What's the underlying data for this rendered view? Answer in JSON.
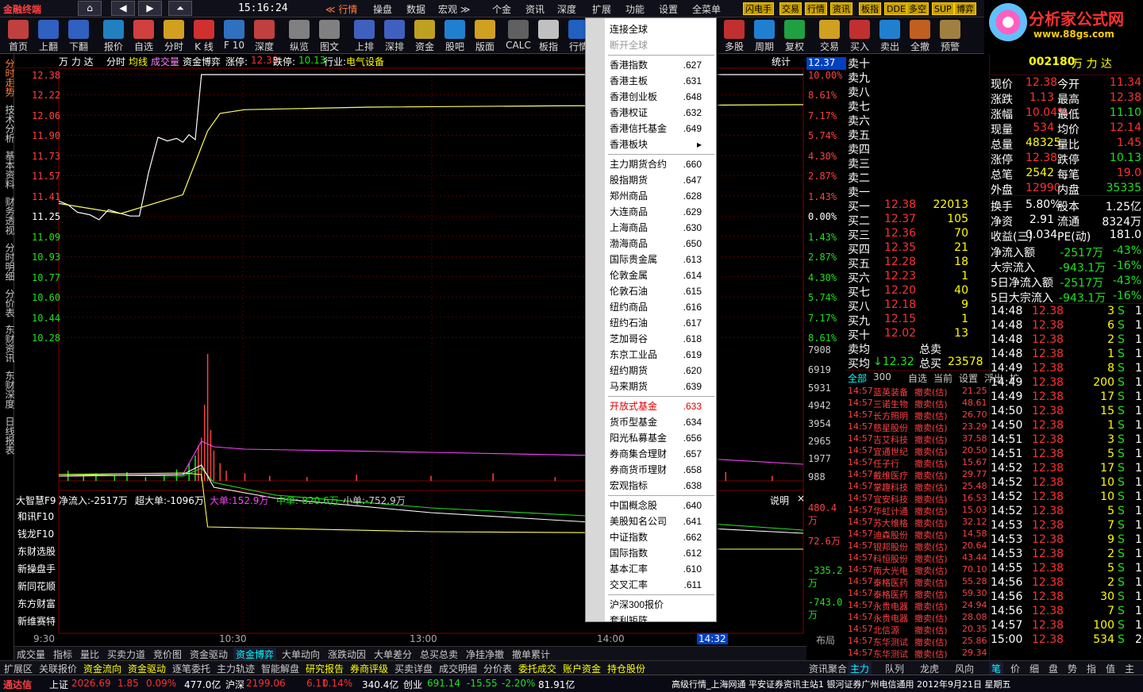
{
  "app": {
    "name": "金融终端",
    "clock": "15:16:24"
  },
  "nav": {
    "home": "⌂",
    "back": "◀",
    "fwd": "▶",
    "up": "⏶"
  },
  "topmenu": [
    {
      "label": "≪ 行情",
      "active": true
    },
    {
      "label": "操盘"
    },
    {
      "label": "数据"
    },
    {
      "label": "宏观 ≫"
    },
    {
      "label": "个金"
    },
    {
      "label": "资讯"
    },
    {
      "label": "深度"
    },
    {
      "label": "扩展",
      "active": false
    },
    {
      "label": "功能"
    },
    {
      "label": "设置"
    },
    {
      "label": "全菜单"
    }
  ],
  "quickbtns": [
    "闪电手",
    "交易",
    "行情",
    "资讯",
    "板指",
    "DDE",
    "多空",
    "SUP",
    "博弈"
  ],
  "logo": {
    "title": "分析家公式网",
    "url": "www.88gs.com"
  },
  "toolbar": [
    "首页",
    "上翻",
    "下翻",
    "报价",
    "自选",
    "分时",
    "K 线",
    "F 10",
    "深度",
    "纵览",
    "图文",
    "上排",
    "深排",
    "资金",
    "股吧",
    "版面",
    "CALC",
    "板指",
    "行情",
    "多股",
    "周期",
    "复权",
    "交易",
    "买入",
    "卖出",
    "全撤",
    "预警"
  ],
  "sidetabs": [
    "分时走势",
    "技术分析",
    "基本资料",
    "财务透视",
    "分时明细",
    "分价表",
    "东财资讯",
    "东财深度",
    "日线报表"
  ],
  "header": {
    "name": "万 力 达",
    "mode": "分时",
    "avg": "均线",
    "vol": "成交量",
    "tab": "资金博弈",
    "zt_label": "涨停:",
    "zt": "12.38",
    "dt_label": "跌停:",
    "dt": "10.13",
    "ind_label": "行业:",
    "ind": "电气设备",
    "stat": "统计",
    "cur": "12.37"
  },
  "yaxis": {
    "left": [
      "12.38",
      "12.22",
      "12.06",
      "11.90",
      "11.73",
      "11.57",
      "11.41",
      "11.25",
      "11.09",
      "10.93",
      "10.77",
      "10.60",
      "10.44",
      "10.28"
    ],
    "right": [
      "10.00%",
      "8.61%",
      "7.17%",
      "5.74%",
      "4.30%",
      "2.87%",
      "1.43%",
      "0.00%",
      "1.43%",
      "2.87%",
      "4.30%",
      "5.74%",
      "7.17%",
      "8.61%"
    ],
    "vol": [
      "7908",
      "6919",
      "5931",
      "4942",
      "3954",
      "2965",
      "1977",
      "988"
    ]
  },
  "dde": {
    "title": "大智慧F9",
    "net": "净流入:-2517万",
    "super": "超大单:-1096万",
    "big": "大单:152.9万",
    "mid": "中单:-820.6万",
    "small": "小单:-752.9万",
    "help": "说明",
    "right": [
      "480.4万",
      "72.6万",
      "-335.2万",
      "-743.0万"
    ]
  },
  "leftlinks": [
    "和讯F10",
    "钱龙F10",
    "东财选股",
    "新操盘手",
    "新同花顺",
    "东方财富",
    "新维赛特"
  ],
  "xaxis": [
    "9:30",
    "10:30",
    "13:00",
    "14:00",
    "14:32",
    "布局"
  ],
  "sell": [
    {
      "l": "卖十"
    },
    {
      "l": "卖九"
    },
    {
      "l": "卖八"
    },
    {
      "l": "卖七"
    },
    {
      "l": "卖六"
    },
    {
      "l": "卖五"
    },
    {
      "l": "卖四"
    },
    {
      "l": "卖三"
    },
    {
      "l": "卖二"
    },
    {
      "l": "卖一"
    }
  ],
  "buy": [
    {
      "l": "买一",
      "p": "12.38",
      "v": "22013"
    },
    {
      "l": "买二",
      "p": "12.37",
      "v": "105"
    },
    {
      "l": "买三",
      "p": "12.36",
      "v": "70"
    },
    {
      "l": "买四",
      "p": "12.35",
      "v": "21"
    },
    {
      "l": "买五",
      "p": "12.28",
      "v": "18"
    },
    {
      "l": "买六",
      "p": "12.23",
      "v": "1"
    },
    {
      "l": "买七",
      "p": "12.20",
      "v": "40"
    },
    {
      "l": "买八",
      "p": "12.18",
      "v": "9"
    },
    {
      "l": "买九",
      "p": "12.15",
      "v": "1"
    },
    {
      "l": "买十",
      "p": "12.02",
      "v": "13"
    }
  ],
  "avgrow": {
    "sell_l": "卖均",
    "sell_t": "总卖",
    "buy_l": "买均",
    "buy_p": "↓12.32",
    "buy_t": "总买",
    "buy_v": "23578"
  },
  "stock": {
    "code": "002180",
    "name": "万 力 达"
  },
  "quote": [
    {
      "a": "现价",
      "b": "12.38",
      "c": "今开",
      "d": "11.34"
    },
    {
      "a": "涨跌",
      "b": "1.13",
      "c": "最高",
      "d": "12.38"
    },
    {
      "a": "涨幅",
      "b": "10.04%",
      "c": "最低",
      "d": "11.10"
    },
    {
      "a": "现量",
      "b": "534",
      "c": "均价",
      "d": "12.14"
    },
    {
      "a": "总量",
      "b": "48325",
      "c": "量比",
      "d": "1.45"
    },
    {
      "a": "涨停",
      "b": "12.38",
      "c": "跌停",
      "d": "10.13"
    },
    {
      "a": "总笔",
      "b": "2542",
      "c": "每笔",
      "d": "19.0"
    },
    {
      "a": "外盘",
      "b": "12990",
      "c": "内盘",
      "d": "35335"
    }
  ],
  "fin": [
    {
      "a": "换手",
      "b": "5.80%",
      "c": "股本",
      "d": "1.25亿"
    },
    {
      "a": "净资",
      "b": "2.91",
      "c": "流通",
      "d": "8324万"
    },
    {
      "a": "收益(三)",
      "b": "0.034",
      "c": "PE(动)",
      "d": "181.0"
    }
  ],
  "flow": [
    {
      "a": "净流入额",
      "b": "-2517万",
      "c": "-43%"
    },
    {
      "a": "大宗流入",
      "b": "-943.1万",
      "c": "-16%"
    },
    {
      "a": "5日净流入额",
      "b": "-2517万",
      "c": "-43%"
    },
    {
      "a": "5日大宗流入",
      "b": "-943.1万",
      "c": "-16%"
    }
  ],
  "ticks": [
    {
      "t": "14:48",
      "p": "12.38",
      "v": "3",
      "s": "S",
      "n": "1"
    },
    {
      "t": "14:48",
      "p": "12.38",
      "v": "6",
      "s": "S",
      "n": "1"
    },
    {
      "t": "14:48",
      "p": "12.38",
      "v": "2",
      "s": "S",
      "n": "1"
    },
    {
      "t": "14:48",
      "p": "12.38",
      "v": "1",
      "s": "S",
      "n": "1"
    },
    {
      "t": "14:49",
      "p": "12.38",
      "v": "8",
      "s": "S",
      "n": "1"
    },
    {
      "t": "14:49",
      "p": "12.38",
      "v": "200",
      "s": "S",
      "n": "1"
    },
    {
      "t": "14:49",
      "p": "12.38",
      "v": "17",
      "s": "S",
      "n": "1"
    },
    {
      "t": "14:50",
      "p": "12.38",
      "v": "15",
      "s": "S",
      "n": "1"
    },
    {
      "t": "14:50",
      "p": "12.38",
      "v": "1",
      "s": "S",
      "n": "1"
    },
    {
      "t": "14:51",
      "p": "12.38",
      "v": "3",
      "s": "S",
      "n": "1"
    },
    {
      "t": "14:51",
      "p": "12.38",
      "v": "5",
      "s": "S",
      "n": "1"
    },
    {
      "t": "14:52",
      "p": "12.38",
      "v": "17",
      "s": "S",
      "n": "1"
    },
    {
      "t": "14:52",
      "p": "12.38",
      "v": "10",
      "s": "S",
      "n": "1"
    },
    {
      "t": "14:52",
      "p": "12.38",
      "v": "10",
      "s": "S",
      "n": "1"
    },
    {
      "t": "14:52",
      "p": "12.38",
      "v": "5",
      "s": "S",
      "n": "1"
    },
    {
      "t": "14:53",
      "p": "12.38",
      "v": "7",
      "s": "S",
      "n": "1"
    },
    {
      "t": "14:53",
      "p": "12.38",
      "v": "9",
      "s": "S",
      "n": "1"
    },
    {
      "t": "14:53",
      "p": "12.38",
      "v": "2",
      "s": "S",
      "n": "1"
    },
    {
      "t": "14:55",
      "p": "12.38",
      "v": "5",
      "s": "S",
      "n": "1"
    },
    {
      "t": "14:56",
      "p": "12.38",
      "v": "2",
      "s": "S",
      "n": "1"
    },
    {
      "t": "14:56",
      "p": "12.38",
      "v": "30",
      "s": "S",
      "n": "1"
    },
    {
      "t": "14:56",
      "p": "12.38",
      "v": "7",
      "s": "S",
      "n": "1"
    },
    {
      "t": "14:57",
      "p": "12.38",
      "v": "100",
      "s": "S",
      "n": "1"
    },
    {
      "t": "15:00",
      "p": "12.38",
      "v": "534",
      "s": "S",
      "n": "20"
    }
  ],
  "newsTabs": [
    "全部",
    "300",
    "自选",
    "当前",
    "设置",
    "浮出",
    "扩"
  ],
  "news": [
    {
      "t": "14:57",
      "n": "蓝英装备",
      "a": "撤卖(估)",
      "v": "21.25"
    },
    {
      "t": "14:57",
      "n": "三诺生物",
      "a": "撤卖(估)",
      "v": "48.61"
    },
    {
      "t": "14:57",
      "n": "长方照明",
      "a": "撤卖(估)",
      "v": "26.70"
    },
    {
      "t": "14:57",
      "n": "慈星股份",
      "a": "撤卖(估)",
      "v": "23.29"
    },
    {
      "t": "14:57",
      "n": "吉艾科技",
      "a": "撤卖(估)",
      "v": "37.58"
    },
    {
      "t": "14:57",
      "n": "宜通世纪",
      "a": "撤卖(估)",
      "v": "20.50"
    },
    {
      "t": "14:57",
      "n": "任子行",
      "a": "撤卖(估)",
      "v": "15.67"
    },
    {
      "t": "14:57",
      "n": "戴维医疗",
      "a": "撤卖(估)",
      "v": "29.77"
    },
    {
      "t": "14:57",
      "n": "掌趣科技",
      "a": "撤卖(估)",
      "v": "25.48"
    },
    {
      "t": "14:57",
      "n": "宜安科技",
      "a": "撤卖(估)",
      "v": "16.53"
    },
    {
      "t": "14:57",
      "n": "华虹计通",
      "a": "撤卖(估)",
      "v": "15.03"
    },
    {
      "t": "14:57",
      "n": "苏大维格",
      "a": "撤卖(估)",
      "v": "32.12"
    },
    {
      "t": "14:57",
      "n": "迪森股份",
      "a": "撤卖(估)",
      "v": "14.58"
    },
    {
      "t": "14:57",
      "n": "银邦股份",
      "a": "撤卖(估)",
      "v": "20.64"
    },
    {
      "t": "14:57",
      "n": "科恒股份",
      "a": "撤卖(估)",
      "v": "43.44"
    },
    {
      "t": "14:57",
      "n": "南大光电",
      "a": "撤卖(估)",
      "v": "70.10"
    },
    {
      "t": "14:57",
      "n": "泰格医药",
      "a": "撤卖(估)",
      "v": "55.28"
    },
    {
      "t": "14:57",
      "n": "泰格医药",
      "a": "撤卖(估)",
      "v": "59.30"
    },
    {
      "t": "14:57",
      "n": "永贵电器",
      "a": "撤卖(估)",
      "v": "24.94"
    },
    {
      "t": "14:57",
      "n": "永贵电器",
      "a": "撤卖(估)",
      "v": "28.08"
    },
    {
      "t": "14:57",
      "n": "北信源",
      "a": "撤卖(估)",
      "v": "20.35"
    },
    {
      "t": "14:57",
      "n": "东华测试",
      "a": "撤卖(估)",
      "v": "25.86"
    },
    {
      "t": "14:57",
      "n": "东华测试",
      "a": "撤卖(估)",
      "v": "29.34"
    }
  ],
  "dropdown": [
    {
      "label": "连接全球",
      "code": ""
    },
    {
      "label": "断开全球",
      "code": "",
      "disabled": true
    },
    {
      "sep": true
    },
    {
      "label": "香港指数",
      "code": ".627"
    },
    {
      "label": "香港主板",
      "code": ".631"
    },
    {
      "label": "香港创业板",
      "code": ".648"
    },
    {
      "label": "香港权证",
      "code": ".632"
    },
    {
      "label": "香港信托基金",
      "code": ".649"
    },
    {
      "label": "香港板块",
      "code": "▸"
    },
    {
      "sep": true
    },
    {
      "label": "主力期货合约",
      "code": ".660"
    },
    {
      "label": "股指期货",
      "code": ".647"
    },
    {
      "label": "郑州商品",
      "code": ".628"
    },
    {
      "label": "大连商品",
      "code": ".629"
    },
    {
      "label": "上海商品",
      "code": ".630"
    },
    {
      "label": "渤海商品",
      "code": ".650"
    },
    {
      "label": "国际贵金属",
      "code": ".613"
    },
    {
      "label": "伦敦金属",
      "code": ".614"
    },
    {
      "label": "伦敦石油",
      "code": ".615"
    },
    {
      "label": "纽约商品",
      "code": ".616"
    },
    {
      "label": "纽约石油",
      "code": ".617"
    },
    {
      "label": "芝加哥谷",
      "code": ".618"
    },
    {
      "label": "东京工业品",
      "code": ".619"
    },
    {
      "label": "纽约期货",
      "code": ".620"
    },
    {
      "label": "马来期货",
      "code": ".639"
    },
    {
      "sep": true
    },
    {
      "label": "开放式基金",
      "code": ".633",
      "hl": true
    },
    {
      "label": "货币型基金",
      "code": ".634"
    },
    {
      "label": "阳光私募基金",
      "code": ".656"
    },
    {
      "label": "券商集合理财",
      "code": ".657"
    },
    {
      "label": "券商货币理财",
      "code": ".658"
    },
    {
      "label": "宏观指标",
      "code": ".638"
    },
    {
      "sep": true
    },
    {
      "label": "中国概念股",
      "code": ".640"
    },
    {
      "label": "美股知名公司",
      "code": ".641"
    },
    {
      "label": "中证指数",
      "code": ".662"
    },
    {
      "label": "国际指数",
      "code": ".612"
    },
    {
      "label": "基本汇率",
      "code": ".610"
    },
    {
      "label": "交叉汇率",
      "code": ".611"
    },
    {
      "sep": true
    },
    {
      "label": "沪深300报价",
      "code": ""
    },
    {
      "label": "套利矩阵",
      "code": ""
    }
  ],
  "bottomtabs": [
    "成交量",
    "指标",
    "量比",
    "买卖力道",
    "竞价图",
    "资金驱动",
    "资金博弈",
    "大单动向",
    "涨跌动因",
    "大单差分",
    "总买总卖",
    "净挂净撤",
    "撤单累计"
  ],
  "bottomtabs2": [
    "扩展区",
    "关联报价",
    "资金流向",
    "资金驱动",
    "逐笔委托",
    "主力轨迹",
    "智能解盘",
    "研究报告",
    "券商评级",
    "买卖详盘",
    "成交明细",
    "分价表",
    "委托成交",
    "账户资金",
    "持仓股份"
  ],
  "rightbottom": [
    "资讯聚合"
  ],
  "rtabs": [
    "主力",
    "队列",
    "龙虎",
    "风向"
  ],
  "rtabs2": [
    "笔",
    "价",
    "细",
    "盘",
    "势",
    "指",
    "值",
    "主"
  ],
  "status": {
    "brand": "通达信",
    "sh_l": "上证",
    "sh": "2026.69",
    "sh_c": "1.85",
    "sh_p": "0.09%",
    "sh_v": "477.0亿",
    "hs_l": "沪深",
    "hs": "2199.06",
    "hs_c": "6.11",
    "hs_p": "0.14%",
    "hs_v": "340.4亿",
    "cy_l": "创业",
    "cy": "691.14",
    "cy_c": "-15.55",
    "cy_p": "-2.20%",
    "cy_v": "81.91亿",
    "info": "高级行情_上海网通  平安证券资讯主站1  银河证券广州电信通用  2012年9月21日 星期五"
  },
  "chart_data": {
    "type": "line",
    "price_x": [
      0,
      3,
      6,
      10,
      13,
      16,
      20,
      23,
      26,
      29,
      32,
      35,
      38,
      40,
      42,
      44,
      46,
      48,
      50,
      54,
      60,
      70,
      100,
      150,
      200,
      240
    ],
    "price": [
      11.37,
      11.34,
      11.28,
      11.26,
      11.22,
      11.3,
      11.27,
      11.25,
      11.25,
      11.6,
      11.88,
      11.85,
      11.87,
      11.84,
      11.9,
      11.86,
      12.38,
      12.38,
      12.38,
      12.38,
      12.38,
      12.38,
      12.38,
      12.38,
      12.38,
      12.38
    ],
    "avg_x": [
      0,
      20,
      40,
      48,
      52,
      60,
      100,
      160,
      240
    ],
    "avg": [
      11.35,
      11.27,
      11.42,
      11.93,
      12.07,
      12.1,
      12.12,
      12.13,
      12.14
    ]
  }
}
